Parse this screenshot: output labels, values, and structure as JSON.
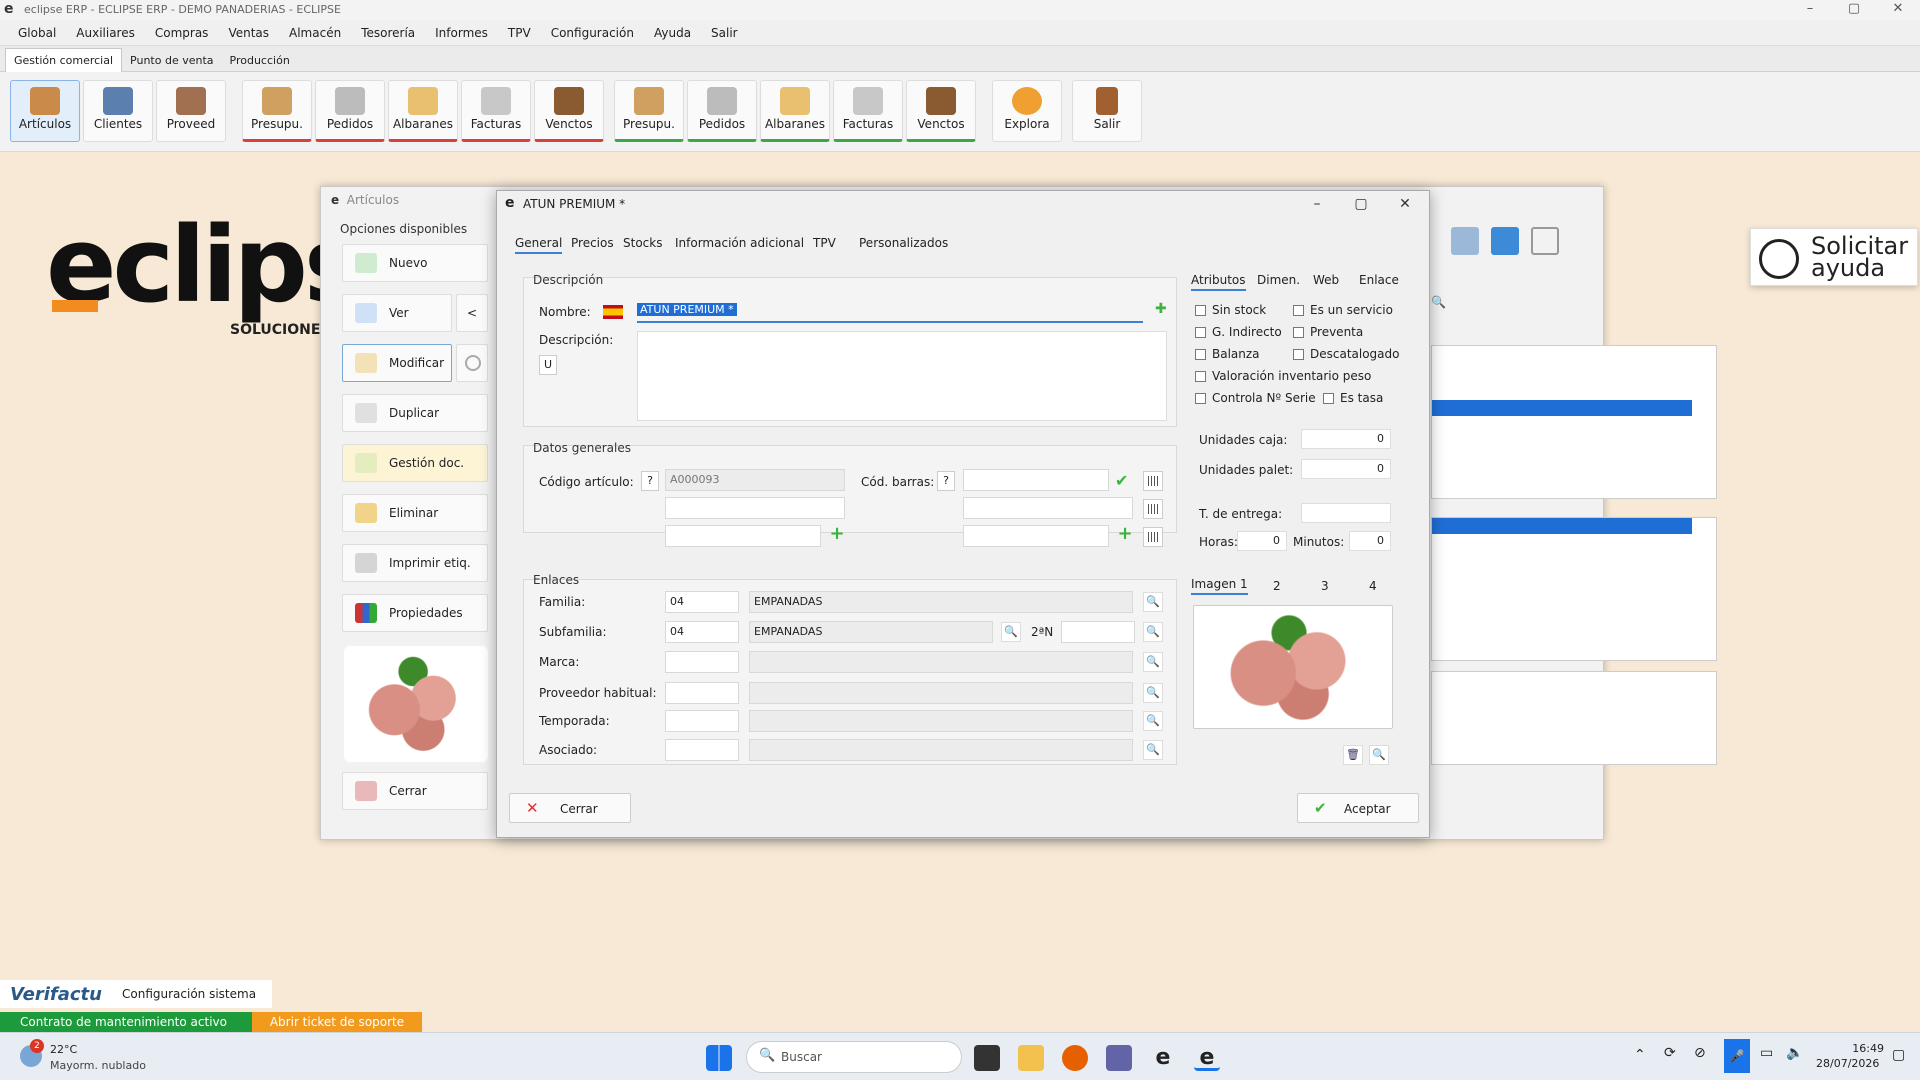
{
  "titlebar": {
    "title": "eclipse ERP  -  ECLIPSE ERP  -  DEMO PANADERIAS - ECLIPSE",
    "min": "–",
    "max": "▢",
    "close": "✕"
  },
  "menu": [
    "Global",
    "Auxiliares",
    "Compras",
    "Ventas",
    "Almacén",
    "Tesorería",
    "Informes",
    "TPV",
    "Configuración",
    "Ayuda",
    "Salir"
  ],
  "subtabs": [
    "Gestión comercial",
    "Punto de venta",
    "Producción"
  ],
  "toolbar": [
    {
      "label": "Artículos",
      "color": "#c98a4a"
    },
    {
      "label": "Clientes",
      "color": "#5b80b0"
    },
    {
      "label": "Proveed",
      "color": "#a07050"
    },
    {
      "label": "Presupu.",
      "color": "#d0a060"
    },
    {
      "label": "Pedidos",
      "color": "#bcbcbc"
    },
    {
      "label": "Albaranes",
      "color": "#e8c070"
    },
    {
      "label": "Facturas",
      "color": "#c8c8c8"
    },
    {
      "label": "Venctos",
      "color": "#8a5a30"
    },
    {
      "label": "Presupu.",
      "color": "#d0a060"
    },
    {
      "label": "Pedidos",
      "color": "#bcbcbc"
    },
    {
      "label": "Albaranes",
      "color": "#e8c070"
    },
    {
      "label": "Facturas",
      "color": "#c8c8c8"
    },
    {
      "label": "Venctos",
      "color": "#8a5a30"
    },
    {
      "label": "Explora",
      "color": "#f0a030"
    },
    {
      "label": "Salir",
      "color": "#a06030"
    }
  ],
  "bg": {
    "logo": "eclipse",
    "sub": "SOLUCIONES"
  },
  "articulos": {
    "title": "Artículos",
    "options_header": "Opciones disponibles",
    "options": [
      "Nuevo",
      "Ver",
      "Modificar",
      "Duplicar",
      "Gestión doc.",
      "Eliminar",
      "Imprimir etiq.",
      "Propiedades"
    ],
    "collapse": "<",
    "close": "Cerrar"
  },
  "modal": {
    "title": "ATUN PREMIUM *",
    "tabs": [
      "General",
      "Precios",
      "Stocks",
      "Información adicional",
      "TPV",
      "Personalizados"
    ],
    "descripcion_group": "Descripción",
    "nombre_label": "Nombre:",
    "nombre_value": "ATUN PREMIUM *",
    "descripcion_label": "Descripción:",
    "u_btn": "U",
    "datos_group": "Datos generales",
    "codigo_label": "Código artículo:",
    "codigo_value": "A000093",
    "q": "?",
    "barras_label": "Cód. barras:",
    "enlaces_group": "Enlaces",
    "familia_label": "Familia:",
    "familia_code": "04",
    "familia_desc": "EMPANADAS",
    "subfamilia_label": "Subfamilia:",
    "subfamilia_code": "04",
    "subfamilia_desc": "EMPANADAS",
    "n2_label": "2ªN",
    "marca_label": "Marca:",
    "proveedor_label": "Proveedor habitual:",
    "temporada_label": "Temporada:",
    "asociado_label": "Asociado:",
    "right_tabs": [
      "Atributos",
      "Dimen.",
      "Web",
      "Enlace"
    ],
    "checks": [
      "Sin stock",
      "Es un servicio",
      "G. Indirecto",
      "Preventa",
      "Balanza",
      "Descatalogado",
      "Valoración inventario peso",
      "Controla Nº Serie",
      "Es tasa"
    ],
    "unidades_caja_label": "Unidades caja:",
    "unidades_caja": "0",
    "unidades_palet_label": "Unidades palet:",
    "unidades_palet": "0",
    "entrega_label": "T. de entrega:",
    "horas_label": "Horas:",
    "horas": "0",
    "minutos_label": "Minutos:",
    "minutos": "0",
    "image_tabs": [
      "Imagen 1",
      "2",
      "3",
      "4"
    ],
    "cerrar": "Cerrar",
    "aceptar": "Aceptar"
  },
  "help": {
    "text1": "Solicitar",
    "text2": "ayuda"
  },
  "status": {
    "verifactu": "Verifactu",
    "config": "Configuración sistema",
    "contract": "Contrato de mantenimiento activo",
    "ticket": "Abrir ticket de soporte"
  },
  "taskbar": {
    "weather_temp": "22°C",
    "weather_desc": "Mayorm. nublado",
    "badge": "2",
    "search": "Buscar",
    "time": "16:49",
    "date": "28/07/2026"
  }
}
